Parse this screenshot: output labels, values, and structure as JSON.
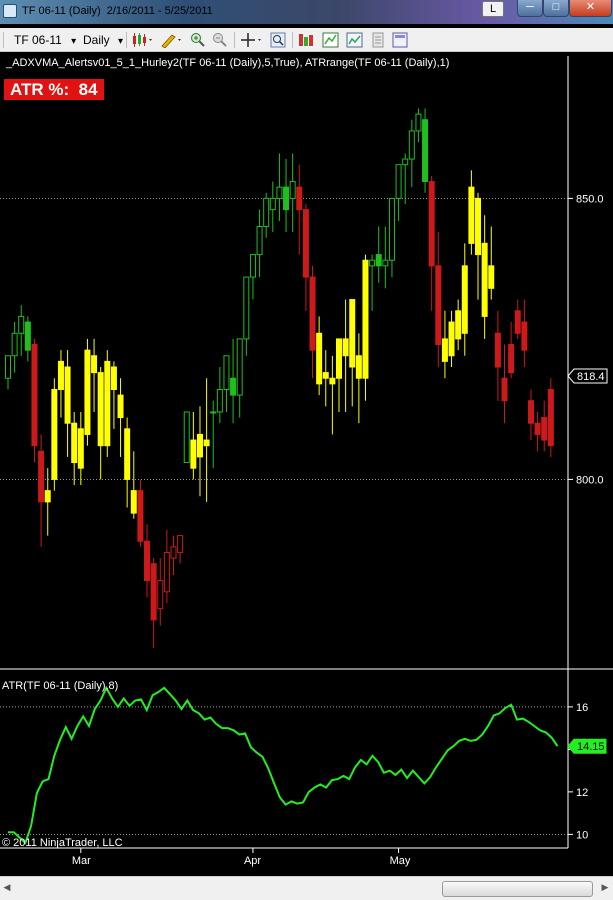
{
  "window": {
    "title": "TF 06-11 (Daily)  2/16/2011 - 5/25/2011",
    "l_button": "L",
    "minimize_glyph": "─",
    "maximize_glyph": "□",
    "close_glyph": "✕"
  },
  "toolbar": {
    "instrument": "TF 06-11",
    "interval": "Daily",
    "dropdown_glyph": "▾",
    "icons": [
      "candlestick-style-icon",
      "pencil-draw-icon",
      "zoom-in-icon",
      "zoom-out-icon",
      "crosshair-icon",
      "magnifier-icon",
      "strategies-icon",
      "indicators-icon",
      "chart-properties-icon",
      "data-box-icon",
      "display-icon"
    ]
  },
  "indicator_label": "_ADXVMA_Alertsv01_5_1_Hurley2(TF 06-11 (Daily),5,True), ATRrange(TF 06-11 (Daily),1)",
  "atr_badge": "ATR %:  84",
  "atr_panel_label": "ATR(TF 06-11 (Daily),8)",
  "copyright": "© 2011 NinjaTrader, LLC",
  "colors": {
    "up_green": "#1fbf1f",
    "yellow": "#ffff00",
    "down_red": "#cc1a1a",
    "atr_line": "#22ee22",
    "badge_red": "#e01212"
  },
  "chart_data": {
    "type": "candlestick",
    "price_axis": {
      "ticks": [
        800.0,
        850.0
      ],
      "last_price_label": "818.4",
      "range": [
        770,
        870
      ]
    },
    "atr_axis": {
      "ticks": [
        10,
        12,
        14,
        16
      ],
      "last_value_label": "14.15",
      "range": [
        9.5,
        17.5
      ]
    },
    "x_labels": [
      {
        "label": "Mar",
        "index": 11
      },
      {
        "label": "Apr",
        "index": 37
      },
      {
        "label": "May",
        "index": 59
      }
    ],
    "candles": [
      {
        "o": 818,
        "h": 822,
        "l": 816,
        "c": 822,
        "color": "green"
      },
      {
        "o": 822,
        "h": 828,
        "l": 819,
        "c": 826,
        "color": "green"
      },
      {
        "o": 826,
        "h": 831,
        "l": 822,
        "c": 829,
        "color": "green"
      },
      {
        "o": 828,
        "h": 829,
        "l": 821,
        "c": 823,
        "color": "green"
      },
      {
        "o": 824,
        "h": 825,
        "l": 803,
        "c": 806,
        "color": "red"
      },
      {
        "o": 805,
        "h": 808,
        "l": 788,
        "c": 796,
        "color": "red"
      },
      {
        "o": 796,
        "h": 802,
        "l": 790,
        "c": 798,
        "color": "yellow"
      },
      {
        "o": 800,
        "h": 818,
        "l": 798,
        "c": 816,
        "color": "yellow"
      },
      {
        "o": 816,
        "h": 823,
        "l": 811,
        "c": 821,
        "color": "yellow"
      },
      {
        "o": 820,
        "h": 823,
        "l": 804,
        "c": 810,
        "color": "yellow"
      },
      {
        "o": 810,
        "h": 812,
        "l": 799,
        "c": 803,
        "color": "yellow"
      },
      {
        "o": 802,
        "h": 812,
        "l": 799,
        "c": 809,
        "color": "yellow"
      },
      {
        "o": 808,
        "h": 825,
        "l": 806,
        "c": 823,
        "color": "yellow"
      },
      {
        "o": 822,
        "h": 825,
        "l": 812,
        "c": 819,
        "color": "yellow"
      },
      {
        "o": 819,
        "h": 820,
        "l": 800,
        "c": 806,
        "color": "yellow"
      },
      {
        "o": 806,
        "h": 823,
        "l": 804,
        "c": 821,
        "color": "yellow"
      },
      {
        "o": 820,
        "h": 821,
        "l": 809,
        "c": 816,
        "color": "yellow"
      },
      {
        "o": 815,
        "h": 818,
        "l": 804,
        "c": 811,
        "color": "yellow"
      },
      {
        "o": 809,
        "h": 811,
        "l": 795,
        "c": 800,
        "color": "yellow"
      },
      {
        "o": 798,
        "h": 805,
        "l": 793,
        "c": 794,
        "color": "yellow"
      },
      {
        "o": 798,
        "h": 800,
        "l": 788,
        "c": 789,
        "color": "red"
      },
      {
        "o": 789,
        "h": 792,
        "l": 779,
        "c": 782,
        "color": "red"
      },
      {
        "o": 785,
        "h": 786,
        "l": 770,
        "c": 775,
        "color": "red"
      },
      {
        "o": 777,
        "h": 786,
        "l": 774,
        "c": 782,
        "color": "red"
      },
      {
        "o": 780,
        "h": 791,
        "l": 778,
        "c": 787,
        "color": "red"
      },
      {
        "o": 786,
        "h": 790,
        "l": 783,
        "c": 788,
        "color": "red"
      },
      {
        "o": 787,
        "h": 790,
        "l": 785,
        "c": 790,
        "color": "red"
      },
      {
        "o": 803,
        "h": 812,
        "l": 803,
        "c": 812,
        "color": "green"
      },
      {
        "o": 807,
        "h": 812,
        "l": 800,
        "c": 802,
        "color": "yellow"
      },
      {
        "o": 804,
        "h": 813,
        "l": 797,
        "c": 808,
        "color": "yellow"
      },
      {
        "o": 807,
        "h": 818,
        "l": 796,
        "c": 806,
        "color": "yellow"
      },
      {
        "o": 812,
        "h": 814,
        "l": 802,
        "c": 812,
        "color": "green"
      },
      {
        "o": 812,
        "h": 820,
        "l": 810,
        "c": 816,
        "color": "green"
      },
      {
        "o": 816,
        "h": 822,
        "l": 812,
        "c": 822,
        "color": "green"
      },
      {
        "o": 818,
        "h": 825,
        "l": 810,
        "c": 815,
        "color": "green"
      },
      {
        "o": 815,
        "h": 825,
        "l": 811,
        "c": 825,
        "color": "green"
      },
      {
        "o": 825,
        "h": 836,
        "l": 822,
        "c": 836,
        "color": "green"
      },
      {
        "o": 836,
        "h": 840,
        "l": 832,
        "c": 840,
        "color": "green"
      },
      {
        "o": 840,
        "h": 848,
        "l": 836,
        "c": 845,
        "color": "green"
      },
      {
        "o": 845,
        "h": 851,
        "l": 843,
        "c": 850,
        "color": "green"
      },
      {
        "o": 848,
        "h": 853,
        "l": 844,
        "c": 850,
        "color": "green"
      },
      {
        "o": 850,
        "h": 858,
        "l": 846,
        "c": 852,
        "color": "green"
      },
      {
        "o": 852,
        "h": 857,
        "l": 844,
        "c": 848,
        "color": "green"
      },
      {
        "o": 850,
        "h": 858,
        "l": 844,
        "c": 853,
        "color": "green"
      },
      {
        "o": 852,
        "h": 856,
        "l": 840,
        "c": 848,
        "color": "red"
      },
      {
        "o": 848,
        "h": 849,
        "l": 830,
        "c": 836,
        "color": "red"
      },
      {
        "o": 836,
        "h": 838,
        "l": 818,
        "c": 823,
        "color": "red"
      },
      {
        "o": 826,
        "h": 829,
        "l": 815,
        "c": 817,
        "color": "yellow"
      },
      {
        "o": 818,
        "h": 823,
        "l": 813,
        "c": 819,
        "color": "yellow"
      },
      {
        "o": 817,
        "h": 822,
        "l": 808,
        "c": 818,
        "color": "yellow"
      },
      {
        "o": 818,
        "h": 825,
        "l": 812,
        "c": 825,
        "color": "yellow"
      },
      {
        "o": 825,
        "h": 832,
        "l": 812,
        "c": 822,
        "color": "yellow"
      },
      {
        "o": 820,
        "h": 832,
        "l": 813,
        "c": 832,
        "color": "yellow"
      },
      {
        "o": 822,
        "h": 826,
        "l": 810,
        "c": 818,
        "color": "yellow"
      },
      {
        "o": 818,
        "h": 840,
        "l": 814,
        "c": 839,
        "color": "yellow"
      },
      {
        "o": 838,
        "h": 840,
        "l": 830,
        "c": 839,
        "color": "green"
      },
      {
        "o": 840,
        "h": 845,
        "l": 835,
        "c": 838,
        "color": "green"
      },
      {
        "o": 838,
        "h": 845,
        "l": 834,
        "c": 839,
        "color": "green"
      },
      {
        "o": 839,
        "h": 850,
        "l": 836,
        "c": 850,
        "color": "green"
      },
      {
        "o": 850,
        "h": 856,
        "l": 846,
        "c": 856,
        "color": "green"
      },
      {
        "o": 856,
        "h": 858,
        "l": 849,
        "c": 857,
        "color": "green"
      },
      {
        "o": 857,
        "h": 864,
        "l": 852,
        "c": 862,
        "color": "green"
      },
      {
        "o": 862,
        "h": 866,
        "l": 860,
        "c": 865,
        "color": "green"
      },
      {
        "o": 864,
        "h": 866,
        "l": 851,
        "c": 853,
        "color": "green"
      },
      {
        "o": 853,
        "h": 854,
        "l": 830,
        "c": 838,
        "color": "red"
      },
      {
        "o": 838,
        "h": 844,
        "l": 820,
        "c": 824,
        "color": "red"
      },
      {
        "o": 825,
        "h": 830,
        "l": 818,
        "c": 821,
        "color": "yellow"
      },
      {
        "o": 822,
        "h": 830,
        "l": 820,
        "c": 828,
        "color": "yellow"
      },
      {
        "o": 825,
        "h": 832,
        "l": 823,
        "c": 830,
        "color": "yellow"
      },
      {
        "o": 826,
        "h": 842,
        "l": 822,
        "c": 838,
        "color": "yellow"
      },
      {
        "o": 842,
        "h": 855,
        "l": 840,
        "c": 852,
        "color": "yellow"
      },
      {
        "o": 850,
        "h": 851,
        "l": 832,
        "c": 840,
        "color": "yellow"
      },
      {
        "o": 842,
        "h": 847,
        "l": 825,
        "c": 829,
        "color": "yellow"
      },
      {
        "o": 838,
        "h": 845,
        "l": 832,
        "c": 834,
        "color": "yellow"
      },
      {
        "o": 826,
        "h": 830,
        "l": 814,
        "c": 820,
        "color": "red"
      },
      {
        "o": 818,
        "h": 824,
        "l": 810,
        "c": 814,
        "color": "red"
      },
      {
        "o": 824,
        "h": 828,
        "l": 818,
        "c": 819,
        "color": "red"
      },
      {
        "o": 830,
        "h": 832,
        "l": 825,
        "c": 826,
        "color": "red"
      },
      {
        "o": 828,
        "h": 832,
        "l": 820,
        "c": 823,
        "color": "red"
      },
      {
        "o": 814,
        "h": 816,
        "l": 807,
        "c": 810,
        "color": "red"
      },
      {
        "o": 810,
        "h": 812,
        "l": 805,
        "c": 808,
        "color": "red"
      },
      {
        "o": 811,
        "h": 814,
        "l": 805,
        "c": 807,
        "color": "red"
      },
      {
        "o": 816,
        "h": 818,
        "l": 804,
        "c": 806,
        "color": "red"
      }
    ],
    "atr_values": [
      10.1,
      10.1,
      9.85,
      9.6,
      10.4,
      11.95,
      12.5,
      12.6,
      13.7,
      14.45,
      15.05,
      14.5,
      15.1,
      15.55,
      15.1,
      15.9,
      16.3,
      16.9,
      16.4,
      16.0,
      16.4,
      16.05,
      16.3,
      16.35,
      15.85,
      16.55,
      16.7,
      16.9,
      16.6,
      16.3,
      15.9,
      16.3,
      15.85,
      15.7,
      15.4,
      15.5,
      15.2,
      15.0,
      15.0,
      14.9,
      14.7,
      14.75,
      14.1,
      13.85,
      13.65,
      13.1,
      12.4,
      11.75,
      11.4,
      11.55,
      11.45,
      11.5,
      12.0,
      12.2,
      12.35,
      12.2,
      12.55,
      12.6,
      12.75,
      12.6,
      13.15,
      13.5,
      13.3,
      13.7,
      13.4,
      12.9,
      13.0,
      12.8,
      13.05,
      12.65,
      13.0,
      12.7,
      12.4,
      12.7,
      13.15,
      13.55,
      13.95,
      14.15,
      14.4,
      14.5,
      14.4,
      14.45,
      14.7,
      15.1,
      15.6,
      15.7,
      15.95,
      16.1,
      15.4,
      15.45,
      15.3,
      15.1,
      14.9,
      14.8,
      14.55,
      14.15
    ],
    "atr_x_span": 83,
    "grid": true
  }
}
